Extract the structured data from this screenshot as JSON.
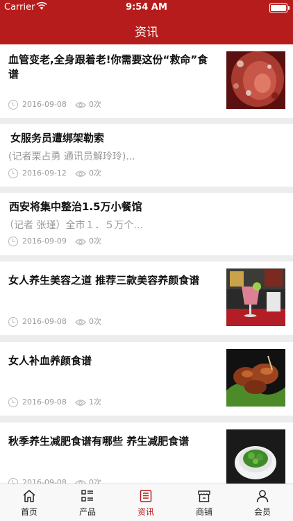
{
  "status_bar": {
    "carrier": "Carrier",
    "time": "9:54 AM"
  },
  "header": {
    "title": "资讯"
  },
  "articles": [
    {
      "title": "血管变老,全身跟着老!你需要这份“救命”食谱",
      "summary": "",
      "date": "2016-09-08",
      "views": "0次"
    },
    {
      "title": "女服务员遭绑架勒索",
      "summary": "(记者栗占勇 通讯员解玲玲)...",
      "date": "2016-09-12",
      "views": "0次"
    },
    {
      "title": "西安将集中整治1.5万小餐馆",
      "summary": "（记者 张瑾）全市１．５万个...",
      "date": "2016-09-09",
      "views": "0次"
    },
    {
      "title": "女人养生美容之道 推荐三款美容养颜食谱",
      "summary": "",
      "date": "2016-09-08",
      "views": "0次"
    },
    {
      "title": "女人补血养颜食谱",
      "summary": "",
      "date": "2016-09-08",
      "views": "1次"
    },
    {
      "title": "秋季养生减肥食谱有哪些 养生减肥食谱",
      "summary": "",
      "date": "2016-09-08",
      "views": "0次"
    }
  ],
  "tabs": [
    {
      "label": "首页",
      "icon": "home-icon"
    },
    {
      "label": "产品",
      "icon": "list-icon"
    },
    {
      "label": "资讯",
      "icon": "news-icon",
      "active": true
    },
    {
      "label": "商铺",
      "icon": "shop-icon"
    },
    {
      "label": "会员",
      "icon": "user-icon"
    }
  ],
  "colors": {
    "accent": "#b71c1c",
    "background": "#ededed"
  }
}
